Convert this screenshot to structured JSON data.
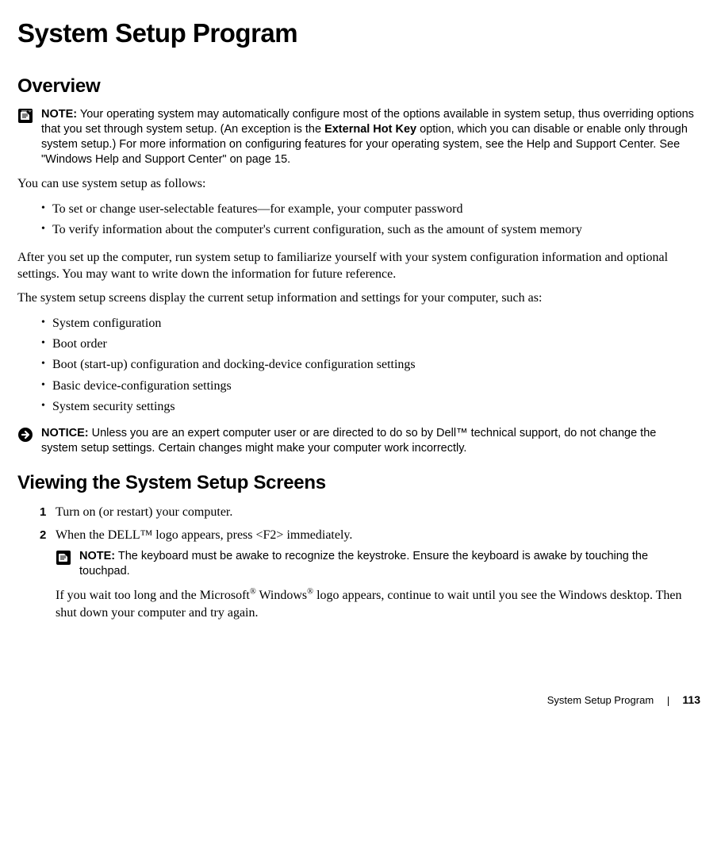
{
  "title": "System Setup Program",
  "sections": {
    "overview": {
      "heading": "Overview",
      "note": {
        "label": "NOTE:",
        "pre": " Your operating system may automatically configure most of the options available in system setup, thus overriding options that you set through system setup. (An exception is the ",
        "bold_inline": "External Hot Key",
        "post": " option, which you can disable or enable only through system setup.) For more information on configuring features for your operating system, see the Help and Support Center. See \"Windows Help and Support Center\" on page 15."
      },
      "intro": "You can use system setup as follows:",
      "bullets1": [
        "To set or change user-selectable features—for example, your computer password",
        "To verify information about the computer's current configuration, such as the amount of system memory"
      ],
      "para2": "After you set up the computer, run system setup to familiarize yourself with your system configuration information and optional settings. You may want to write down the information for future reference.",
      "para3": "The system setup screens display the current setup information and settings for your computer, such as:",
      "bullets2": [
        "System configuration",
        "Boot order",
        "Boot (start-up) configuration and docking-device configuration settings",
        "Basic device-configuration settings",
        "System security settings"
      ],
      "notice": {
        "label": "NOTICE:",
        "text": " Unless you are an expert computer user or are directed to do so by Dell™ technical support, do not change the system setup settings. Certain changes might make your computer work incorrectly."
      }
    },
    "viewing": {
      "heading": "Viewing the System Setup Screens",
      "steps": [
        {
          "num": "1",
          "text": "Turn on (or restart) your computer."
        },
        {
          "num": "2",
          "text": "When the DELL™ logo appears, press <F2> immediately."
        }
      ],
      "sub_note": {
        "label": "NOTE:",
        "text": " The keyboard must be awake to recognize the keystroke. Ensure the keyboard is awake by touching the touchpad."
      },
      "sub_para_pre": "If you wait too long and the Microsoft",
      "sub_para_mid": " Windows",
      "sub_para_post": " logo appears, continue to wait until you see the Windows desktop. Then shut down your computer and try again.",
      "reg": "®"
    }
  },
  "footer": {
    "section": "System Setup Program",
    "page": "113"
  }
}
